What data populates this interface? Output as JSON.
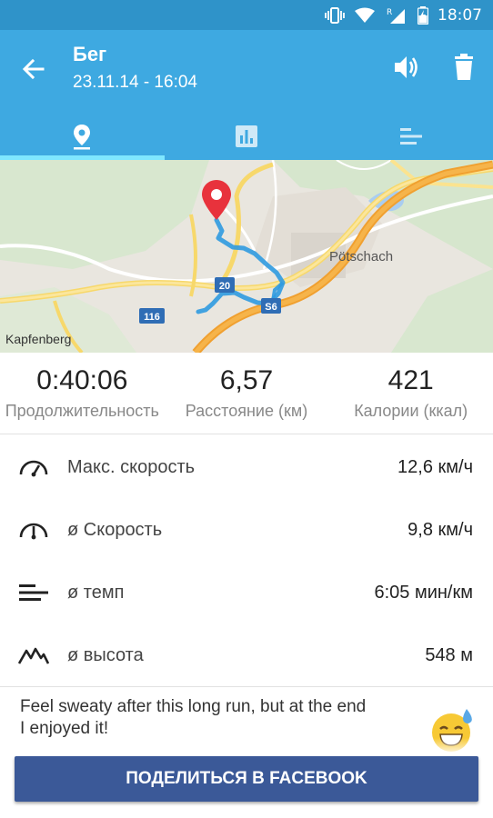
{
  "status_bar": {
    "time": "18:07",
    "roaming_letter": "R"
  },
  "header": {
    "title": "Бег",
    "subtitle": "23.11.14 - 16:04"
  },
  "tabs": [
    {
      "name": "map",
      "icon": "location-pin-icon",
      "active": true
    },
    {
      "name": "charts",
      "icon": "bar-chart-icon",
      "active": false
    },
    {
      "name": "splits",
      "icon": "splits-list-icon",
      "active": false
    }
  ],
  "map": {
    "labels": {
      "city": "Pötschach",
      "town": "Kapfenberg",
      "road_116": "116",
      "road_20": "20",
      "road_s6": "S6"
    }
  },
  "summary": [
    {
      "value": "0:40:06",
      "label": "Продолжительность"
    },
    {
      "value": "6,57",
      "label": "Расстояние (км)"
    },
    {
      "value": "421",
      "label": "Калории (ккал)"
    }
  ],
  "stats": [
    {
      "icon": "speedometer-icon",
      "label": "Макс. скорость",
      "value": "12,6 км/ч"
    },
    {
      "icon": "speedometer-icon",
      "label": "ø Скорость",
      "value": "9,8 км/ч"
    },
    {
      "icon": "pace-icon",
      "label": "ø темп",
      "value": "6:05 мин/км"
    },
    {
      "icon": "elevation-icon",
      "label": "ø высота",
      "value": "548 м"
    }
  ],
  "note": "Feel sweaty after this long run, but at the end I enjoyed it!",
  "share_button": "ПОДЕЛИТЬСЯ В FACEBOOK",
  "colors": {
    "status_bar": "#2f93c9",
    "app_bar": "#3ea9e1",
    "tab_indicator": "#7fe7ff",
    "facebook": "#3b5998",
    "route": "#3ea9e1",
    "pin": "#e8323c"
  }
}
